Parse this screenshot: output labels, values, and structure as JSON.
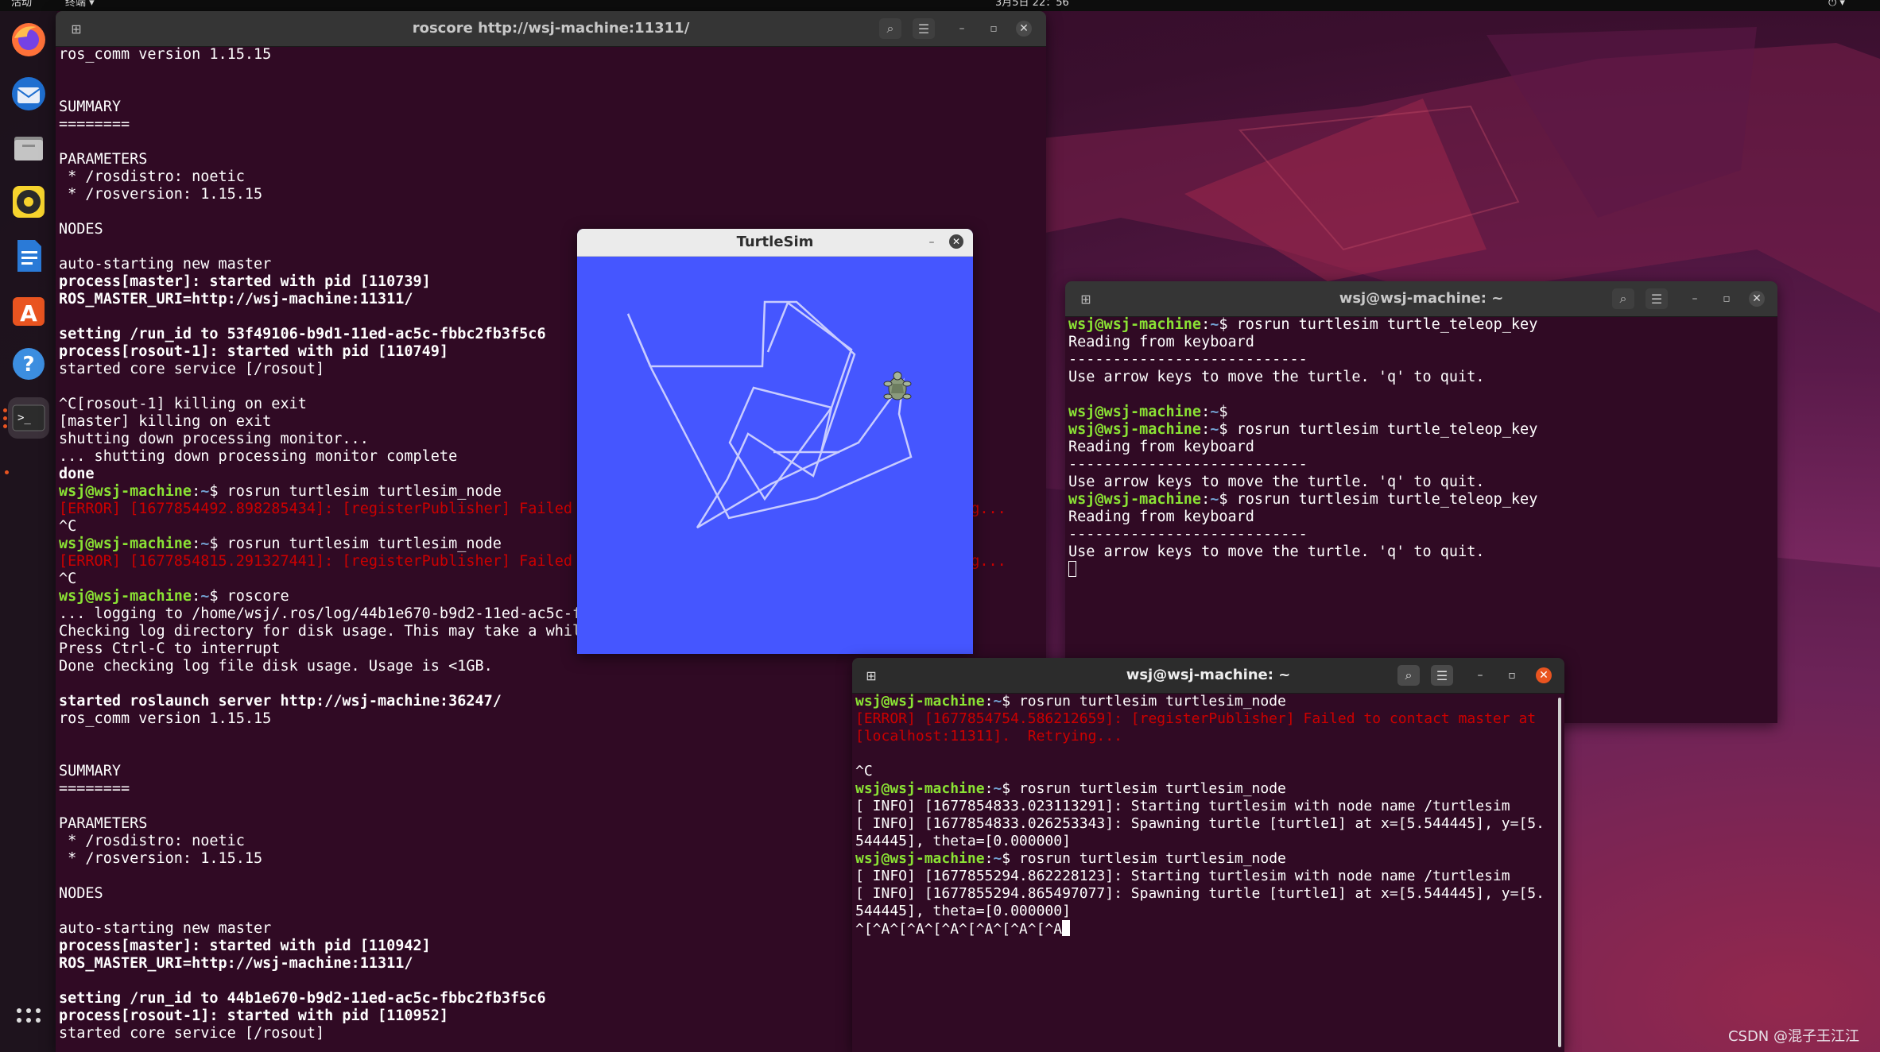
{
  "topbar": {
    "activities": "活动",
    "app_menu": "终端 ▾",
    "clock": "3月5日 22：56"
  },
  "dock": {
    "items": [
      "firefox-icon",
      "thunderbird-icon",
      "files-icon",
      "rhythmbox-icon",
      "writer-icon",
      "software-icon",
      "help-icon",
      "terminal-icon",
      "apps-grid-icon"
    ]
  },
  "win1": {
    "title": "roscore http://wsj-machine:11311/",
    "lines": [
      {
        "t": "ros_comm version 1.15.15",
        "c": "n"
      },
      {
        "t": "",
        "c": "n"
      },
      {
        "t": "",
        "c": "n"
      },
      {
        "t": "SUMMARY",
        "c": "n"
      },
      {
        "t": "========",
        "c": "n"
      },
      {
        "t": "",
        "c": "n"
      },
      {
        "t": "PARAMETERS",
        "c": "n"
      },
      {
        "t": " * /rosdistro: noetic",
        "c": "n"
      },
      {
        "t": " * /rosversion: 1.15.15",
        "c": "n"
      },
      {
        "t": "",
        "c": "n"
      },
      {
        "t": "NODES",
        "c": "n"
      },
      {
        "t": "",
        "c": "n"
      },
      {
        "t": "auto-starting new master",
        "c": "n"
      },
      {
        "t": "process[master]: started with pid [110739]",
        "c": "b"
      },
      {
        "t": "ROS_MASTER_URI=http://wsj-machine:11311/",
        "c": "b"
      },
      {
        "t": "",
        "c": "n"
      },
      {
        "t": "setting /run_id to 53f49106-b9d1-11ed-ac5c-fbbc2fb3f5c6",
        "c": "b"
      },
      {
        "t": "process[rosout-1]: started with pid [110749]",
        "c": "b"
      },
      {
        "t": "started core service [/rosout]",
        "c": "n"
      },
      {
        "t": "",
        "c": "n"
      },
      {
        "t": "^C[rosout-1] killing on exit",
        "c": "n"
      },
      {
        "t": "[master] killing on exit",
        "c": "n"
      },
      {
        "t": "shutting down processing monitor...",
        "c": "n"
      },
      {
        "t": "... shutting down processing monitor complete",
        "c": "n"
      },
      {
        "t": "done",
        "c": "b"
      },
      {
        "t": "rosrun turtlesim turtlesim_node",
        "c": "p"
      },
      {
        "t": "[ERROR] [1677854492.898285434]: [registerPublisher] Failed                                          ying...",
        "c": "e"
      },
      {
        "t": "^C",
        "c": "n"
      },
      {
        "t": "rosrun turtlesim turtlesim_node",
        "c": "p"
      },
      {
        "t": "[ERROR] [1677854815.291327441]: [registerPublisher] Failed                                          ying...",
        "c": "e"
      },
      {
        "t": "^C",
        "c": "n"
      },
      {
        "t": "roscore",
        "c": "p"
      },
      {
        "t": "... logging to /home/wsj/.ros/log/44b1e670-b9d2-11ed-ac5c-f",
        "c": "n"
      },
      {
        "t": "Checking log directory for disk usage. This may take a while",
        "c": "n"
      },
      {
        "t": "Press Ctrl-C to interrupt",
        "c": "n"
      },
      {
        "t": "Done checking log file disk usage. Usage is <1GB.",
        "c": "n"
      },
      {
        "t": "",
        "c": "n"
      },
      {
        "t": "started roslaunch server http://wsj-machine:36247/",
        "c": "b"
      },
      {
        "t": "ros_comm version 1.15.15",
        "c": "n"
      },
      {
        "t": "",
        "c": "n"
      },
      {
        "t": "",
        "c": "n"
      },
      {
        "t": "SUMMARY",
        "c": "n"
      },
      {
        "t": "========",
        "c": "n"
      },
      {
        "t": "",
        "c": "n"
      },
      {
        "t": "PARAMETERS",
        "c": "n"
      },
      {
        "t": " * /rosdistro: noetic",
        "c": "n"
      },
      {
        "t": " * /rosversion: 1.15.15",
        "c": "n"
      },
      {
        "t": "",
        "c": "n"
      },
      {
        "t": "NODES",
        "c": "n"
      },
      {
        "t": "",
        "c": "n"
      },
      {
        "t": "auto-starting new master",
        "c": "n"
      },
      {
        "t": "process[master]: started with pid [110942]",
        "c": "b"
      },
      {
        "t": "ROS_MASTER_URI=http://wsj-machine:11311/",
        "c": "b"
      },
      {
        "t": "",
        "c": "n"
      },
      {
        "t": "setting /run_id to 44b1e670-b9d2-11ed-ac5c-fbbc2fb3f5c6",
        "c": "b"
      },
      {
        "t": "process[rosout-1]: started with pid [110952]",
        "c": "b"
      },
      {
        "t": "started core service [/rosout]",
        "c": "n"
      }
    ]
  },
  "prompt": {
    "user": "wsj@wsj-machine",
    "path": "~",
    "sym": "$ "
  },
  "turtlesim": {
    "title": "TurtleSim",
    "bg": "#4556ff"
  },
  "win2": {
    "title": "wsj@wsj-machine: ~",
    "lines": [
      {
        "t": "rosrun turtlesim turtle_teleop_key",
        "c": "p"
      },
      {
        "t": "Reading from keyboard",
        "c": "n"
      },
      {
        "t": "---------------------------",
        "c": "n"
      },
      {
        "t": "Use arrow keys to move the turtle. 'q' to quit.",
        "c": "n"
      },
      {
        "t": "",
        "c": "n"
      },
      {
        "t": "",
        "c": "p"
      },
      {
        "t": "rosrun turtlesim turtle_teleop_key",
        "c": "p"
      },
      {
        "t": "Reading from keyboard",
        "c": "n"
      },
      {
        "t": "---------------------------",
        "c": "n"
      },
      {
        "t": "Use arrow keys to move the turtle. 'q' to quit.",
        "c": "n"
      },
      {
        "t": "rosrun turtlesim turtle_teleop_key",
        "c": "p"
      },
      {
        "t": "Reading from keyboard",
        "c": "n"
      },
      {
        "t": "---------------------------",
        "c": "n"
      },
      {
        "t": "Use arrow keys to move the turtle. 'q' to quit.",
        "c": "n"
      }
    ]
  },
  "win3": {
    "title": "wsj@wsj-machine: ~",
    "lines": [
      {
        "t": "rosrun turtlesim turtlesim_node",
        "c": "p"
      },
      {
        "t": "[ERROR] [1677854754.586212659]: [registerPublisher] Failed to contact master at",
        "c": "e"
      },
      {
        "t": "[localhost:11311].  Retrying...",
        "c": "e"
      },
      {
        "t": "",
        "c": "n"
      },
      {
        "t": "^C",
        "c": "n"
      },
      {
        "t": "rosrun turtlesim turtlesim_node",
        "c": "p"
      },
      {
        "t": "[ INFO] [1677854833.023113291]: Starting turtlesim with node name /turtlesim",
        "c": "n"
      },
      {
        "t": "[ INFO] [1677854833.026253343]: Spawning turtle [turtle1] at x=[5.544445], y=[5.",
        "c": "n"
      },
      {
        "t": "544445], theta=[0.000000]",
        "c": "n"
      },
      {
        "t": "rosrun turtlesim turtlesim_node",
        "c": "p"
      },
      {
        "t": "[ INFO] [1677855294.862228123]: Starting turtlesim with node name /turtlesim",
        "c": "n"
      },
      {
        "t": "[ INFO] [1677855294.865497077]: Spawning turtle [turtle1] at x=[5.544445], y=[5.",
        "c": "n"
      },
      {
        "t": "544445], theta=[0.000000]",
        "c": "n"
      },
      {
        "t": "^[^A^[^A^[^A^[^A^[^A^[^A",
        "c": "n"
      }
    ]
  },
  "watermark": "CSDN @混子王江江",
  "colors": {
    "terminal_bg": "#300a24",
    "prompt_green": "#8ae234",
    "path_blue": "#729fcf",
    "error_red": "#cc0000",
    "accent": "#e95420"
  }
}
